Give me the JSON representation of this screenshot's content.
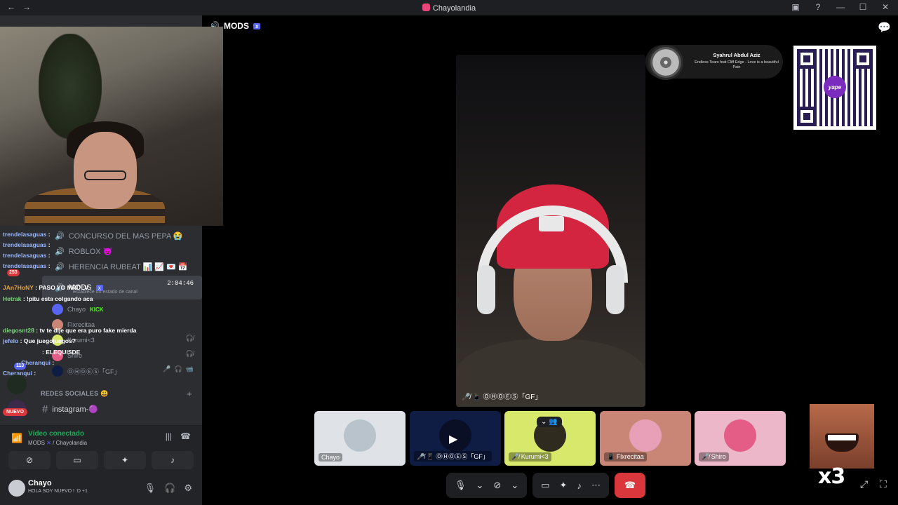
{
  "window": {
    "title": "Chayolandia",
    "nav_back": "←",
    "nav_forward": "→"
  },
  "stream_overlay": {
    "chat_lines": [
      {
        "user": "trendelasaguas",
        "msg": ":"
      },
      {
        "user": "trendelasaguas",
        "msg": ":"
      },
      {
        "user": "trendelasaguas",
        "msg": ":"
      },
      {
        "user": "trendelasaguas",
        "msg": ":"
      },
      {
        "user": "JAn7HoNY",
        "msg": ": PASO YO MRD :V"
      },
      {
        "user": "Hetrak",
        "msg": ": !pitu esta colgando aca"
      },
      {
        "user": "diegosnt28",
        "msg": ": tv te dije que era puro fake mierda"
      },
      {
        "user": "jefelo",
        "msg": ": Que juegojuegos?"
      },
      {
        "user": "",
        "msg": ": ELEQUISDE"
      },
      {
        "user": "Cheranqui",
        "msg": ":"
      },
      {
        "user": "Cheranqui",
        "msg": ":"
      }
    ],
    "nuevo_badge": "NUEVO",
    "badge_253": "253",
    "badge_113": "113"
  },
  "sidebar": {
    "channels": [
      {
        "label": "CONCURSO DEL MAS PEPA 😭"
      },
      {
        "label": "ROBLOX 😈"
      },
      {
        "label": "HERENCIA RUBEAT 📊 📈 💌 📅"
      }
    ],
    "active_voice": {
      "label": "MODS",
      "x_tag": "x",
      "sub": "Establece un estado de canal",
      "timer": "2:04:46"
    },
    "voice_users": [
      {
        "name": "Chayo",
        "extra": "KICK"
      },
      {
        "name": "Flxrecitaa",
        "extra": ""
      },
      {
        "name": "Kurumi<3",
        "extra": ""
      },
      {
        "name": "Shiro",
        "extra": ""
      },
      {
        "name": "ⓄⒽⓄⒺⓈ「GF」",
        "extra": ""
      }
    ],
    "social_category": "REDES SOCIALES 😃",
    "social_channel": "instagram-🟣"
  },
  "voice_panel": {
    "status": "Vídeo conectado",
    "channel": "MODS",
    "server": "/ Chayolandia"
  },
  "user": {
    "name": "Chayo",
    "status": "HOLA SOY NUEVO ! :D +1"
  },
  "stage": {
    "channel_title": "MODS",
    "x_tag": "x",
    "main_participant": "ⓄⒽⓄⒺⓈ「GF」",
    "music": {
      "artist": "Syahrul Abdul Aziz",
      "song": "Endless Tears feat Cliff Edge - Love is a beautiful Pain"
    },
    "qr_logo": "yape",
    "tiles": [
      {
        "name": "Chayo",
        "bg": "#dfe3e8",
        "av": "#b8c3cc"
      },
      {
        "name": "ⓄⒽⓄⒺⓈ「GF」",
        "bg": "#0f1d45",
        "av": "#0a0f26"
      },
      {
        "name": "Kurumi<3",
        "bg": "#d8e86a",
        "av": "#2f2c1f"
      },
      {
        "name": "Flxrecitaa",
        "bg": "#c98676",
        "av": "#e8a0b8"
      },
      {
        "name": "Shiro",
        "bg": "#ebb7c9",
        "av": "#e35d86"
      }
    ],
    "x3_text": "x3"
  },
  "colors": {
    "accent": "#5865f2",
    "danger": "#da373c",
    "connected": "#23a55a",
    "kick": "#53fc18"
  }
}
